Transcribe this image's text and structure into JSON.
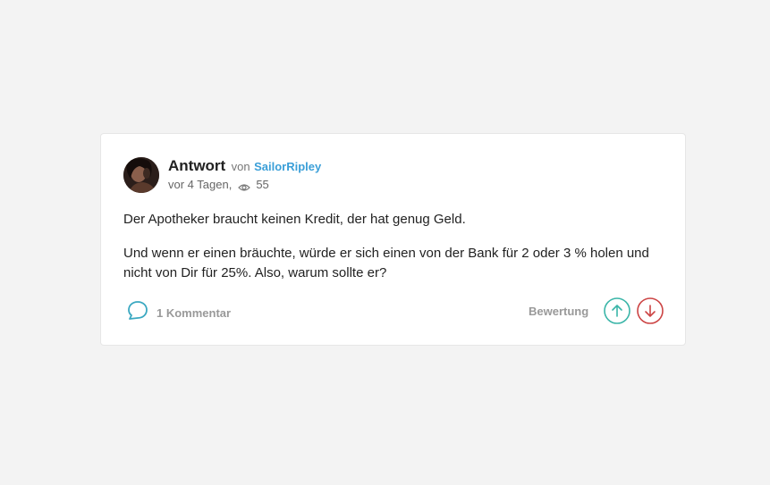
{
  "answer": {
    "title": "Antwort",
    "by_label": "von",
    "author": "SailorRipley",
    "time": "vor 4 Tagen,",
    "views": "55",
    "paragraphs": [
      "Der Apotheker braucht keinen Kredit, der hat genug Geld.",
      "Und wenn er einen bräuchte, würde er sich einen von der Bank für 2 oder 3 % holen und nicht von Dir für 25%. Also, warum sollte er?"
    ]
  },
  "footer": {
    "comments_label": "1 Kommentar",
    "rating_label": "Bewertung"
  },
  "icons": {
    "views": "eye-icon",
    "comments": "speech-bubble-icon",
    "upvote": "arrow-up-circle-icon",
    "downvote": "arrow-down-circle-icon"
  },
  "colors": {
    "author_link": "#3b9fd8",
    "comment_icon": "#3aa8c1",
    "upvote": "#3ab5a8",
    "downvote": "#cc4444"
  }
}
